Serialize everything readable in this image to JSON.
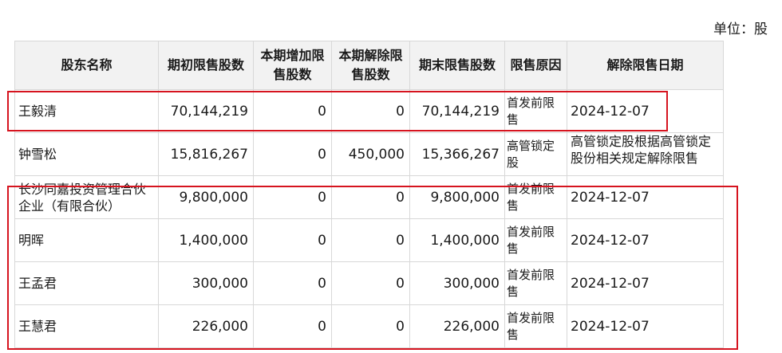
{
  "unit_label": "单位：股",
  "columns": [
    "股东名称",
    "期初限售股数",
    "本期增加限售股数",
    "本期解除限售股数",
    "期末限售股数",
    "限售原因",
    "解除限售日期"
  ],
  "rows": [
    {
      "name": "王毅清",
      "start": "70,144,219",
      "increase": "0",
      "release": "0",
      "end": "70,144,219",
      "reason": "首发前限售",
      "date": "2024-12-07"
    },
    {
      "name": "钟雪松",
      "start": "15,816,267",
      "increase": "0",
      "release": "450,000",
      "end": "15,366,267",
      "reason": "高管锁定股",
      "date": "高管锁定股根据高管锁定 股份相关规定解除限售"
    },
    {
      "name": "长沙同嘉投资管理合伙企业（有限合伙）",
      "start": "9,800,000",
      "increase": "0",
      "release": "0",
      "end": "9,800,000",
      "reason": "首发前限售",
      "date": "2024-12-07"
    },
    {
      "name": "明晖",
      "start": "1,400,000",
      "increase": "0",
      "release": "0",
      "end": "1,400,000",
      "reason": "首发前限售",
      "date": "2024-12-07"
    },
    {
      "name": "王孟君",
      "start": "300,000",
      "increase": "0",
      "release": "0",
      "end": "300,000",
      "reason": "首发前限售",
      "date": "2024-12-07"
    },
    {
      "name": "王慧君",
      "start": "226,000",
      "increase": "0",
      "release": "0",
      "end": "226,000",
      "reason": "首发前限售",
      "date": "2024-12-07"
    }
  ],
  "highlight_color": "#d6141f"
}
